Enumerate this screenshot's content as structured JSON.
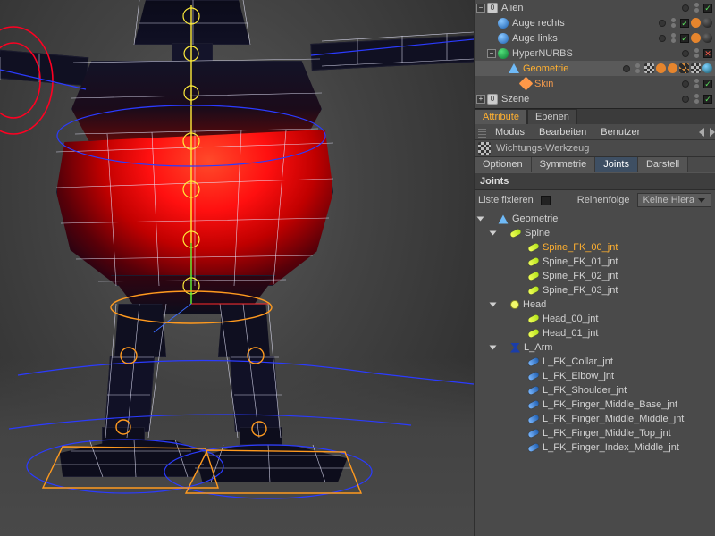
{
  "object_manager": {
    "items": [
      {
        "label": "Alien",
        "type": "null",
        "indent": 0,
        "highlight": false
      },
      {
        "label": "Auge rechts",
        "type": "sphere",
        "indent": 1
      },
      {
        "label": "Auge links",
        "type": "sphere",
        "indent": 1
      },
      {
        "label": "HyperNURBS",
        "type": "hn",
        "indent": 1
      },
      {
        "label": "Geometrie",
        "type": "poly",
        "indent": 2,
        "highlight": true
      },
      {
        "label": "Skin",
        "type": "skin",
        "indent": 3
      },
      {
        "label": "Szene",
        "type": "null",
        "indent": 0
      }
    ]
  },
  "am": {
    "tabs": {
      "attribute": "Attribute",
      "ebenen": "Ebenen"
    },
    "menu": {
      "modus": "Modus",
      "bearbeiten": "Bearbeiten",
      "benutzer": "Benutzer"
    },
    "tool_title": "Wichtungs-Werkzeug",
    "subtabs": {
      "optionen": "Optionen",
      "symmetrie": "Symmetrie",
      "joints": "Joints",
      "darstell": "Darstell"
    },
    "section": "Joints",
    "liste_label": "Liste fixieren",
    "reihenfolge_label": "Reihenfolge",
    "reihenfolge_value": "Keine Hiera"
  },
  "joints": {
    "root": "Geometrie",
    "groups": [
      {
        "label": "Spine",
        "icon": "lime",
        "children": [
          {
            "label": "Spine_FK_00_jnt",
            "hi": true
          },
          {
            "label": "Spine_FK_01_jnt"
          },
          {
            "label": "Spine_FK_02_jnt"
          },
          {
            "label": "Spine_FK_03_jnt"
          }
        ]
      },
      {
        "label": "Head",
        "icon": "head",
        "children": [
          {
            "label": "Head_00_jnt"
          },
          {
            "label": "Head_01_jnt"
          }
        ]
      },
      {
        "label": "L_Arm",
        "icon": "arm",
        "children": [
          {
            "label": "L_FK_Collar_jnt"
          },
          {
            "label": "L_FK_Elbow_jnt"
          },
          {
            "label": "L_FK_Shoulder_jnt"
          },
          {
            "label": "L_FK_Finger_Middle_Base_jnt"
          },
          {
            "label": "L_FK_Finger_Middle_Middle_jnt"
          },
          {
            "label": "L_FK_Finger_Middle_Top_jnt"
          },
          {
            "label": "L_FK_Finger_Index_Middle_jnt"
          }
        ]
      }
    ]
  }
}
